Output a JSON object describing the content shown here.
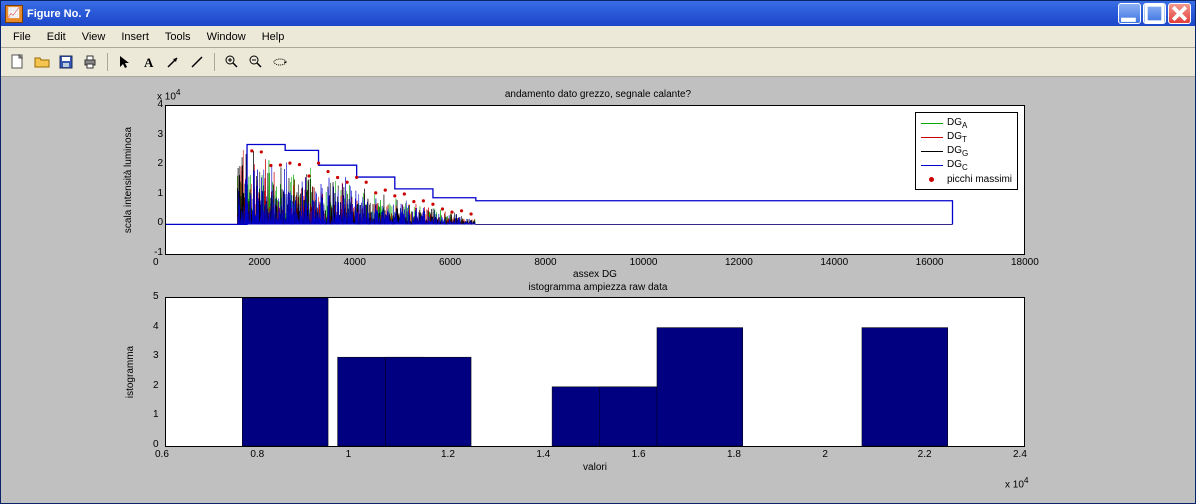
{
  "window": {
    "title": "Figure No. 7"
  },
  "menu": {
    "file": "File",
    "edit": "Edit",
    "view": "View",
    "insert": "Insert",
    "tools": "Tools",
    "window": "Window",
    "help": "Help"
  },
  "chart_data": [
    {
      "type": "line",
      "title": "andamento dato grezzo, segnale calante?",
      "xlabel": "assex DG",
      "ylabel": "scala intensità luminosa",
      "y_scale_label": "x 10",
      "y_scale_exp": "4",
      "x_ticks": [
        0,
        2000,
        4000,
        6000,
        8000,
        10000,
        12000,
        14000,
        16000,
        18000
      ],
      "y_ticks": [
        -1,
        0,
        1,
        2,
        3,
        4
      ],
      "xlim": [
        0,
        18000
      ],
      "ylim": [
        -1,
        4
      ],
      "series": [
        {
          "name": "DG",
          "sub": "A",
          "color": "#00aa00"
        },
        {
          "name": "DG",
          "sub": "T",
          "color": "#cc0000"
        },
        {
          "name": "DG",
          "sub": "G",
          "color": "#000000"
        },
        {
          "name": "DG",
          "sub": "C",
          "color": "#0000cc"
        }
      ],
      "marker_series": {
        "name": "picchi massimi",
        "color": "#cc0000"
      },
      "data_note": "dense noisy multi-channel trace roughly between x=1500..6500, amplitude spikes up to ~3e4, flat zero outside; blue step envelope near ~2.5e4 descending to ~0.8e4; red peak dots on local maxima"
    },
    {
      "type": "bar",
      "title": "istogramma ampiezza raw data",
      "xlabel": "valori",
      "ylabel": "istogramma",
      "x_scale_label": "x 10",
      "x_scale_exp": "4",
      "x_ticks": [
        0.6,
        0.8,
        1.0,
        1.2,
        1.4,
        1.6,
        1.8,
        2.0,
        2.2,
        2.4
      ],
      "y_ticks": [
        0,
        1,
        2,
        3,
        4,
        5
      ],
      "xlim": [
        0.6,
        2.4
      ],
      "ylim": [
        0,
        5
      ],
      "categories": [
        0.85,
        1.05,
        1.15,
        1.5,
        1.6,
        1.72,
        2.15
      ],
      "values": [
        5,
        3,
        3,
        2,
        2,
        4,
        4
      ],
      "bar_color": "#000080"
    }
  ]
}
